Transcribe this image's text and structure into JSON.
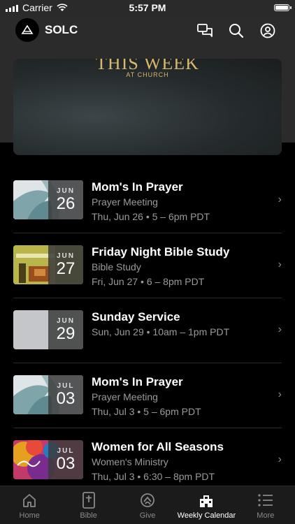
{
  "status": {
    "carrier": "Carrier",
    "time": "5:57 PM"
  },
  "header": {
    "app_name": "SOLC"
  },
  "banner": {
    "title": "THIS WEEK",
    "subtitle": "AT CHURCH"
  },
  "events": [
    {
      "month": "JUN",
      "day": "26",
      "title": "Mom's In Prayer",
      "subtitle": "Prayer Meeting",
      "when": "Thu, Jun 26 • 5 – 6pm PDT",
      "art": "teal"
    },
    {
      "month": "JUN",
      "day": "27",
      "title": "Friday Night Bible Study",
      "subtitle": "Bible Study",
      "when": "Fri, Jun 27 • 6 – 8pm PDT",
      "art": "olive"
    },
    {
      "month": "JUN",
      "day": "29",
      "title": "Sunday Service",
      "subtitle": "",
      "when": "Sun, Jun 29 • 10am – 1pm PDT",
      "art": "grey"
    },
    {
      "month": "JUL",
      "day": "03",
      "title": "Mom's In Prayer",
      "subtitle": "Prayer Meeting",
      "when": "Thu, Jul 3 • 5 – 6pm PDT",
      "art": "teal"
    },
    {
      "month": "JUL",
      "day": "03",
      "title": "Women for All Seasons",
      "subtitle": "Women's Ministry",
      "when": "Thu, Jul 3 • 6:30 – 8pm PDT",
      "art": "color"
    }
  ],
  "tabs": [
    {
      "label": "Home",
      "icon": "home-icon"
    },
    {
      "label": "Bible",
      "icon": "bible-icon"
    },
    {
      "label": "Give",
      "icon": "give-icon"
    },
    {
      "label": "Weekly Calendar",
      "icon": "calendar-building-icon",
      "active": true
    },
    {
      "label": "More",
      "icon": "more-list-icon"
    }
  ]
}
